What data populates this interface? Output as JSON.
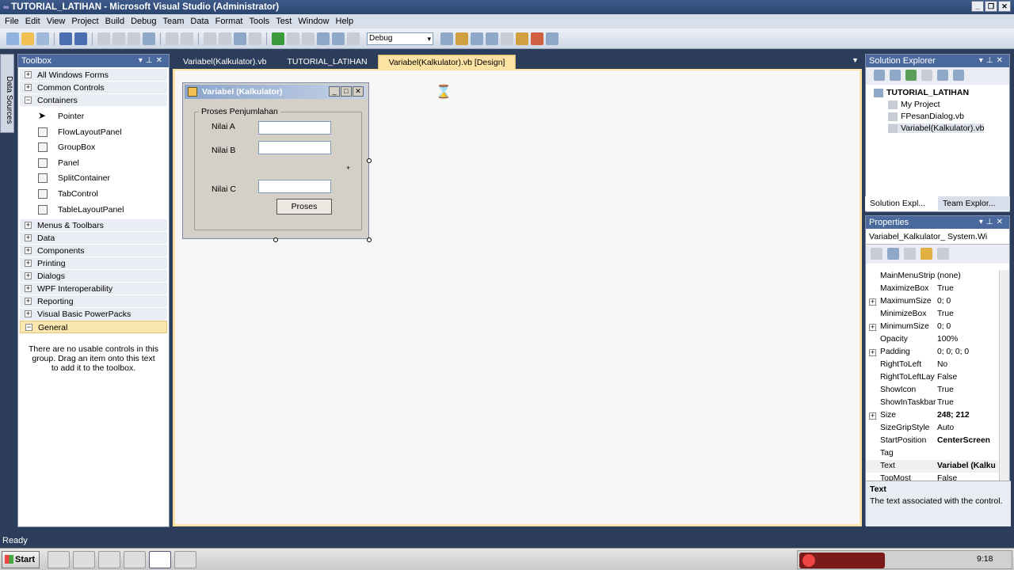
{
  "window": {
    "title": "TUTORIAL_LATIHAN - Microsoft Visual Studio (Administrator)",
    "controls": [
      "_",
      "❐",
      "✕"
    ]
  },
  "menu": [
    "File",
    "Edit",
    "View",
    "Project",
    "Build",
    "Debug",
    "Team",
    "Data",
    "Format",
    "Tools",
    "Test",
    "Window",
    "Help"
  ],
  "toolbar": {
    "config_value": "Debug"
  },
  "data_sources_label": "Data Sources",
  "toolbox": {
    "title": "Toolbox",
    "categories_top": [
      {
        "label": "All Windows Forms",
        "sign": "+"
      },
      {
        "label": "Common Controls",
        "sign": "+"
      },
      {
        "label": "Containers",
        "sign": "−"
      }
    ],
    "container_items": [
      "Pointer",
      "FlowLayoutPanel",
      "GroupBox",
      "Panel",
      "SplitContainer",
      "TabControl",
      "TableLayoutPanel"
    ],
    "categories_bottom": [
      {
        "label": "Menus & Toolbars",
        "sign": "+"
      },
      {
        "label": "Data",
        "sign": "+"
      },
      {
        "label": "Components",
        "sign": "+"
      },
      {
        "label": "Printing",
        "sign": "+"
      },
      {
        "label": "Dialogs",
        "sign": "+"
      },
      {
        "label": "WPF Interoperability",
        "sign": "+"
      },
      {
        "label": "Reporting",
        "sign": "+"
      },
      {
        "label": "Visual Basic PowerPacks",
        "sign": "+"
      },
      {
        "label": "General",
        "sign": "−"
      }
    ],
    "empty_text": "There are no usable controls in this group. Drag an item onto this text to add it to the toolbox."
  },
  "doc_tabs": [
    "Variabel(Kalkulator).vb",
    "TUTORIAL_LATIHAN",
    "Variabel(Kalkulator).vb [Design]"
  ],
  "form": {
    "title": "Variabel (Kalkulator)",
    "group_label": "Proses Penjumlahan",
    "label_a": "Nilai A",
    "label_b": "Nilai B",
    "label_c": "Nilai C",
    "button": "Proses"
  },
  "solution_explorer": {
    "title": "Solution Explorer",
    "root": "TUTORIAL_LATIHAN",
    "items": [
      "My Project",
      "FPesanDialog.vb",
      "Variabel(Kalkulator).vb"
    ],
    "tabs": [
      "Solution Expl...",
      "Team Explor..."
    ]
  },
  "properties": {
    "title": "Properties",
    "object": "Variabel_Kalkulator_  System.Wi",
    "rows": [
      {
        "name": "MainMenuStrip",
        "value": "(none)",
        "exp": false,
        "bold": false
      },
      {
        "name": "MaximizeBox",
        "value": "True",
        "exp": false,
        "bold": false
      },
      {
        "name": "MaximumSize",
        "value": "0; 0",
        "exp": true,
        "bold": false
      },
      {
        "name": "MinimizeBox",
        "value": "True",
        "exp": false,
        "bold": false
      },
      {
        "name": "MinimumSize",
        "value": "0; 0",
        "exp": true,
        "bold": false
      },
      {
        "name": "Opacity",
        "value": "100%",
        "exp": false,
        "bold": false
      },
      {
        "name": "Padding",
        "value": "0; 0; 0; 0",
        "exp": true,
        "bold": false
      },
      {
        "name": "RightToLeft",
        "value": "No",
        "exp": false,
        "bold": false
      },
      {
        "name": "RightToLeftLay",
        "value": "False",
        "exp": false,
        "bold": false
      },
      {
        "name": "ShowIcon",
        "value": "True",
        "exp": false,
        "bold": false
      },
      {
        "name": "ShowInTaskbar",
        "value": "True",
        "exp": false,
        "bold": false
      },
      {
        "name": "Size",
        "value": "248; 212",
        "exp": true,
        "bold": true
      },
      {
        "name": "SizeGripStyle",
        "value": "Auto",
        "exp": false,
        "bold": false
      },
      {
        "name": "StartPosition",
        "value": "CenterScreen",
        "exp": false,
        "bold": true
      },
      {
        "name": "Tag",
        "value": "",
        "exp": false,
        "bold": false
      },
      {
        "name": "Text",
        "value": "Variabel (Kalku",
        "exp": false,
        "bold": true
      },
      {
        "name": "TopMost",
        "value": "False",
        "exp": false,
        "bold": false
      }
    ],
    "desc_title": "Text",
    "desc_text": "The text associated with the control."
  },
  "status": "Ready",
  "taskbar": {
    "start": "Start",
    "clock": "9:18"
  }
}
